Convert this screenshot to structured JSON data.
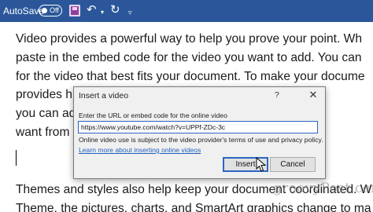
{
  "toolbar": {
    "autosave_label": "AutoSave",
    "autosave_state": "Off",
    "save_icon": "save-icon",
    "undo_icon": "undo-icon",
    "redo_icon": "redo-icon",
    "more_icon": "customize-toolbar-icon"
  },
  "document": {
    "paragraph1_lines": [
      "Video provides a powerful way to help you prove your point. Wh",
      "paste in the embed code for the video you want to add. You can",
      "for the video that best fits your document. To make your docume",
      "provides h                                                   ns that co",
      "you can ad                                                    r. Click In",
      "want from"
    ],
    "paragraph2_lines": [
      "Themes and styles also help keep your document coordinated. W",
      "Theme, the pictures, charts, and SmartArt graphics change to ma"
    ]
  },
  "dialog": {
    "title": "Insert a video",
    "help": "?",
    "close": "✕",
    "url_label": "Enter the URL or embed code for the online video",
    "url_value": "https://www.youtube.com/watch?v=UPPf-ZDc-3c",
    "terms_note": "Online video use is subject to the video provider's terms of use and privacy policy.",
    "learn_more_link": "Learn more about inserting online videos",
    "insert_button": "Insert",
    "cancel_button": "Cancel"
  },
  "watermark": "groovyPost.com",
  "colors": {
    "title_bar": "#2b579a",
    "dialog_bg": "#f0f0f0",
    "link": "#1e5fbf",
    "focus_border": "#2b66c2"
  }
}
